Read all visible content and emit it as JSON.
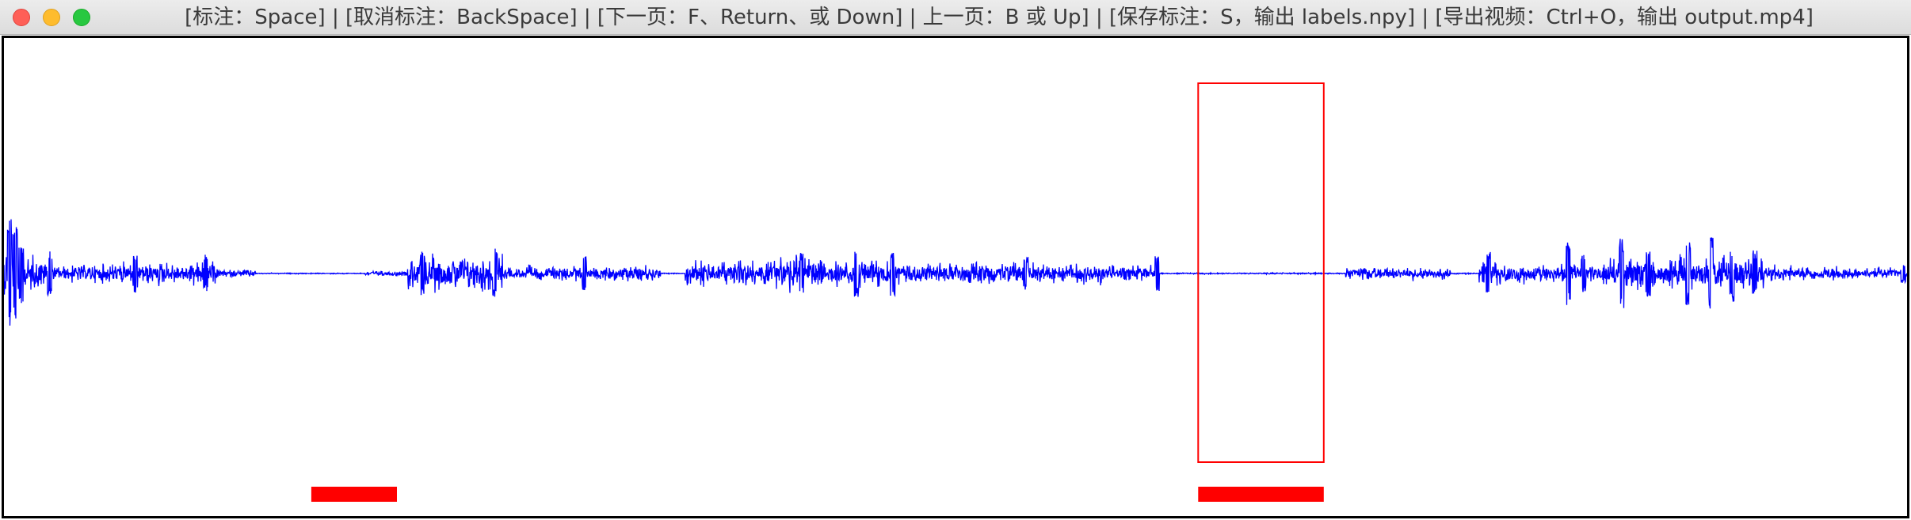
{
  "window": {
    "title": "[标注：Space] | [取消标注：BackSpace] | [下一页：F、Return、或 Down] | 上一页：B 或 Up] | [保存标注：S，输出 labels.npy] | [导出视频：Ctrl+O，输出 output.mp4]",
    "controls": {
      "close": "close-icon",
      "minimize": "minimize-icon",
      "zoom": "zoom-icon"
    }
  },
  "colors": {
    "waveform": "#0000ff",
    "selection": "#ff0000",
    "label_marker": "#ff0000",
    "frame": "#000000"
  },
  "annotation": {
    "labels": [
      {
        "start": 0.1615,
        "end": 0.2065
      },
      {
        "start": 0.6275,
        "end": 0.6935
      }
    ],
    "selection": {
      "start": 0.6275,
      "end": 0.6935
    }
  }
}
